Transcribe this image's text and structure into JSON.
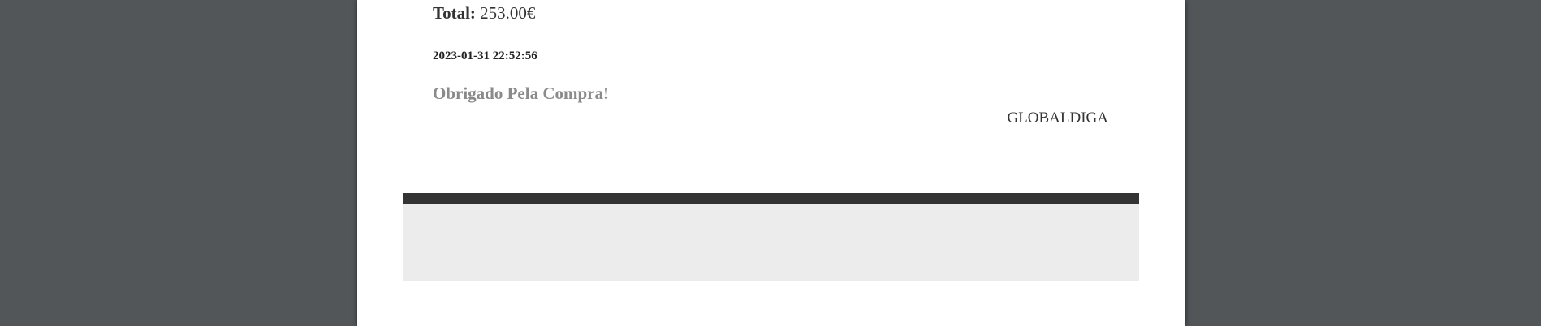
{
  "receipt": {
    "total_label": "Total:",
    "total_value": "253.00€",
    "timestamp": "2023-01-31 22:52:56",
    "thanks_message": "Obrigado Pela Compra!",
    "company_name": "GLOBALDIGA"
  },
  "colors": {
    "viewer_background": "#525659",
    "page_background": "#ffffff",
    "footer_bar": "#333333",
    "footer_box": "#ececec",
    "thanks_text": "#8a8a8a"
  }
}
